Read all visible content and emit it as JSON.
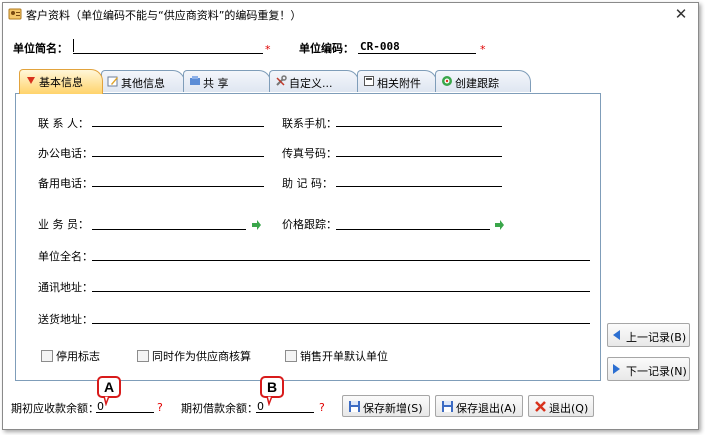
{
  "window": {
    "title": "客户资料（单位编码不能与“供应商资料”的编码重复！）",
    "close_glyph": "✕"
  },
  "header": {
    "unit_name_label": "单位简名：",
    "unit_code_label": "单位编码：",
    "unit_code_value": "CR-008",
    "required_mark": "*"
  },
  "tabs": [
    {
      "label": "基本信息",
      "icon": "red-arrow-icon"
    },
    {
      "label": "其他信息",
      "icon": "edit-icon"
    },
    {
      "label": "共 享",
      "icon": "share-icon"
    },
    {
      "label": "自定义...",
      "icon": "tools-icon"
    },
    {
      "label": "相关附件",
      "icon": "attachment-icon"
    },
    {
      "label": "创建跟踪",
      "icon": "tracking-icon"
    }
  ],
  "fields": {
    "contact": "联 系 人：",
    "mobile": "联系手机：",
    "office_phone": "办公电话：",
    "fax": "传真号码：",
    "backup_phone": "备用电话：",
    "mnemonic": "助 记 码：",
    "salesman": "业 务 员：",
    "price_tracking": "价格跟踪：",
    "full_name": "单位全名：",
    "address": "通讯地址：",
    "delivery_address": "送货地址："
  },
  "checkboxes": {
    "disabled": "停用标志",
    "as_supplier": "同时作为供应商核算",
    "default_sales": "销售开单默认单位"
  },
  "nav": {
    "prev": "上一记录(B)",
    "next": "下一记录(N)"
  },
  "footer": {
    "receivable_label": "期初应收款余额：",
    "receivable_value": "0",
    "borrow_label": "期初借款余额：",
    "borrow_value": "0",
    "question_mark": "?",
    "save_new": "保存新增(S)",
    "save_exit": "保存退出(A)",
    "exit": "退出(Q)"
  },
  "callouts": {
    "a": "A",
    "b": "B"
  },
  "colors": {
    "accent_red": "#d81b1b",
    "tab_active": "#ffd36b",
    "border_blue": "#7f9db9"
  }
}
